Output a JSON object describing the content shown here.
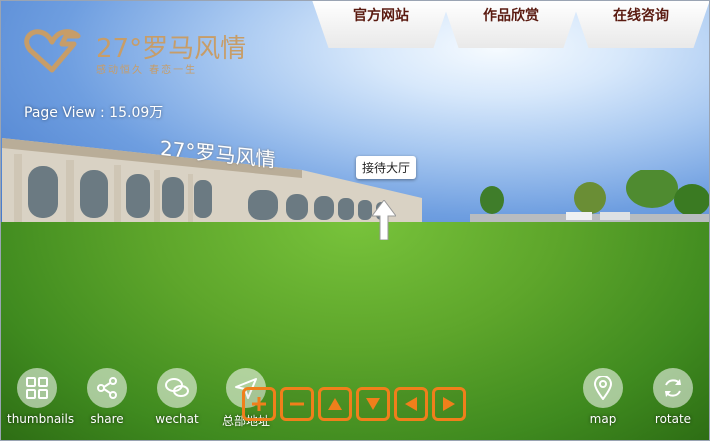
{
  "brand": {
    "name": "27°罗马风情",
    "tagline": "感动恒久  春恋一生",
    "color": "#c79d68"
  },
  "page_view": "Page View : 15.09万",
  "nav": {
    "tabs": [
      "官方网站",
      "作品欣赏",
      "在线咨询"
    ],
    "text_color": "#5a1a10"
  },
  "scene": {
    "hotspot_label": "接待大厅",
    "building_sign": "27°罗马风情"
  },
  "bottom_left": [
    {
      "label": "thumbnails",
      "icon": "grid-icon"
    },
    {
      "label": "share",
      "icon": "share-icon"
    },
    {
      "label": "wechat",
      "icon": "wechat-icon"
    },
    {
      "label": "总部地址",
      "icon": "send-icon"
    }
  ],
  "bottom_right": [
    {
      "label": "map",
      "icon": "map-pin-icon"
    },
    {
      "label": "rotate",
      "icon": "rotate-icon"
    }
  ],
  "controls": {
    "color": "#f07f1b",
    "buttons": [
      "zoom-in-icon",
      "zoom-out-icon",
      "arrow-up-icon",
      "arrow-down-icon",
      "arrow-left-icon",
      "arrow-right-icon"
    ]
  }
}
